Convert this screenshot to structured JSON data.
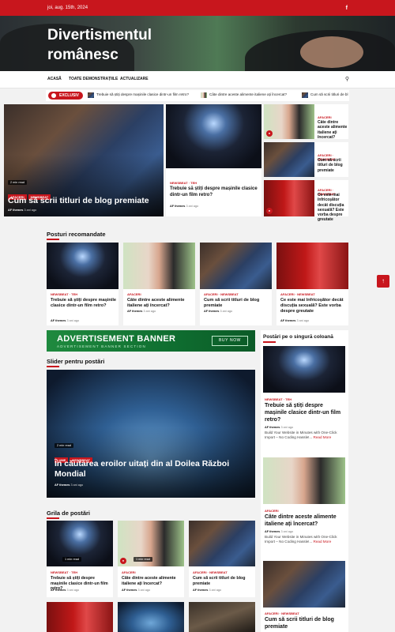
{
  "topbar": {
    "date": "joi, aug. 15th, 2024",
    "social_icon": "f"
  },
  "site": {
    "title": "Divertismentul românesc"
  },
  "nav": {
    "items": [
      "ACASĂ",
      "TOATE DEMONSTRAȚIILE",
      "ACTUALIZARE"
    ],
    "search_icon": "search-icon"
  },
  "ticker": {
    "badge": "EXCLUSIV",
    "items": [
      "Trebuie să știți despre mașinile clasice dintr-un film retro?",
      "Câte dintre aceste alimente italiene ați încercat?",
      "Cum să scrii titluri de bl"
    ]
  },
  "featured": {
    "main": {
      "read": "2 min read",
      "tags": [
        "AFACERI",
        "NEWSBEAT"
      ],
      "title": "Cum să scrii titluri de blog premiate",
      "author": "AF themes",
      "time": "3 ani ago"
    },
    "middle": {
      "cats": "NEWSBEAT · TEH",
      "title": "Trebuie să știți despre mașinile clasice dintr-un film retro?",
      "author": "AF themes",
      "time": "3 ani ago"
    },
    "side": [
      {
        "cats": "AFACERI",
        "title": "Câte dintre aceste alimente italiene ați încercat?"
      },
      {
        "cats": "AFACERI · NEWSBEAT",
        "title": "Cum să scrii titluri de blog premiate"
      },
      {
        "cats": "AFACERI · NEWSBEAT",
        "title": "Ce este mai înfricoșător decât discuția sexuală? Este vorba despre greutate"
      }
    ]
  },
  "recommended": {
    "heading": "Posturi recomandate",
    "items": [
      {
        "cats": "NEWSBEAT · TEH",
        "title": "Trebuie să știți despre mașinile clasice dintr-un film retro?",
        "author": "AF themes",
        "time": "3 ani ago"
      },
      {
        "cats": "AFACERI",
        "title": "Câte dintre aceste alimente italiene ați încercat?",
        "author": "AF themes",
        "time": "3 ani ago"
      },
      {
        "cats": "AFACERI · NEWSBEAT",
        "title": "Cum să scrii titluri de blog premiate",
        "author": "AF themes",
        "time": "3 ani ago"
      },
      {
        "cats": "AFACERI · NEWSBEAT",
        "title": "Ce este mai înfricoșător decât discuția sexuală? Este vorba despre greutate",
        "author": "AF themes",
        "time": "3 ani ago"
      }
    ]
  },
  "ad": {
    "title": "ADVERTISEMENT BANNER",
    "subtitle": "ADVERTISEMENT BANNER SECTION",
    "button": "BUY NOW"
  },
  "slider": {
    "heading": "Slider pentru postări",
    "read": "2 min read",
    "tags": [
      "LUME",
      "NEWSBEAT"
    ],
    "title": "În căutarea eroilor uitați din al Doilea Război Mondial",
    "author": "AF themes",
    "time": "3 ani ago"
  },
  "grid": {
    "heading": "Grila de postări",
    "items": [
      {
        "read": "1 min read",
        "cats": "NEWSBEAT · TEH",
        "title": "Trebuie să știți despre mașinile clasice dintr-un film retro?",
        "author": "AF themes",
        "time": "3 ani ago"
      },
      {
        "read": "1 min read",
        "cats": "AFACERI",
        "title": "Câte dintre aceste alimente italiene ați încercat?",
        "author": "AF themes",
        "time": "3 ani ago"
      },
      {
        "read": "",
        "cats": "AFACERI · NEWSBEAT",
        "title": "Cum să scrii titluri de blog premiate",
        "author": "AF themes",
        "time": "3 ani ago"
      }
    ]
  },
  "sidebar": {
    "heading": "Postări pe o singură coloană",
    "items": [
      {
        "cats": "NEWSBEAT · TEH",
        "title": "Trebuie să știți despre mașinile clasice dintr-un film retro?",
        "author": "AF themes",
        "time": "3 ani ago",
        "excerpt": "Build Your Website in Minutes with One-Click Import – No Coding Hassle!...",
        "more": "Read More"
      },
      {
        "cats": "AFACERI",
        "title": "Câte dintre aceste alimente italiene ați încercat?",
        "author": "AF themes",
        "time": "3 ani ago",
        "excerpt": "Build Your Website in Minutes with One-Click Import – No Coding Hassle!...",
        "more": "Read More"
      },
      {
        "cats": "AFACERI · NEWSBEAT",
        "title": "Cum să scrii titluri de blog premiate"
      }
    ]
  },
  "scroll_top": "↑"
}
